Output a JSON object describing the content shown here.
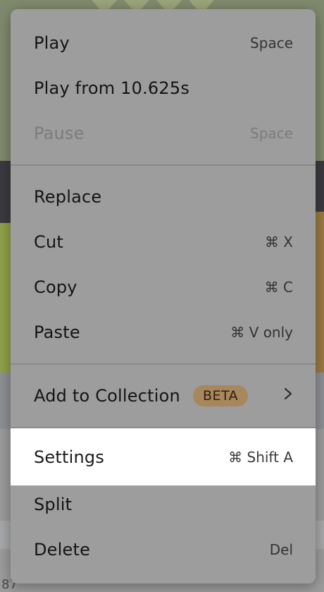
{
  "menu": {
    "items": [
      {
        "label": "Play",
        "shortcut": "Space"
      },
      {
        "label": "Play from 10.625s",
        "shortcut": ""
      },
      {
        "label": "Pause",
        "shortcut": "Space"
      },
      {
        "label": "Replace",
        "shortcut": ""
      },
      {
        "label": "Cut",
        "shortcut": "⌘ X"
      },
      {
        "label": "Copy",
        "shortcut": "⌘ C"
      },
      {
        "label": "Paste",
        "shortcut": "⌘ V only"
      },
      {
        "label": "Add to Collection",
        "badge": "BETA",
        "submenu_icon": "chevron-right-icon"
      },
      {
        "label": "Settings",
        "shortcut": "⌘ Shift A"
      },
      {
        "label": "Split",
        "shortcut": ""
      },
      {
        "label": "Delete",
        "shortcut": "Del"
      }
    ],
    "disabled_item": "Pause",
    "highlighted_item": "Settings"
  },
  "background": {
    "edge_text": "87"
  },
  "colors": {
    "menu_bg": "#9d9d9d",
    "highlight_bg": "#ffffff",
    "badge_bg": "#a9875c"
  }
}
